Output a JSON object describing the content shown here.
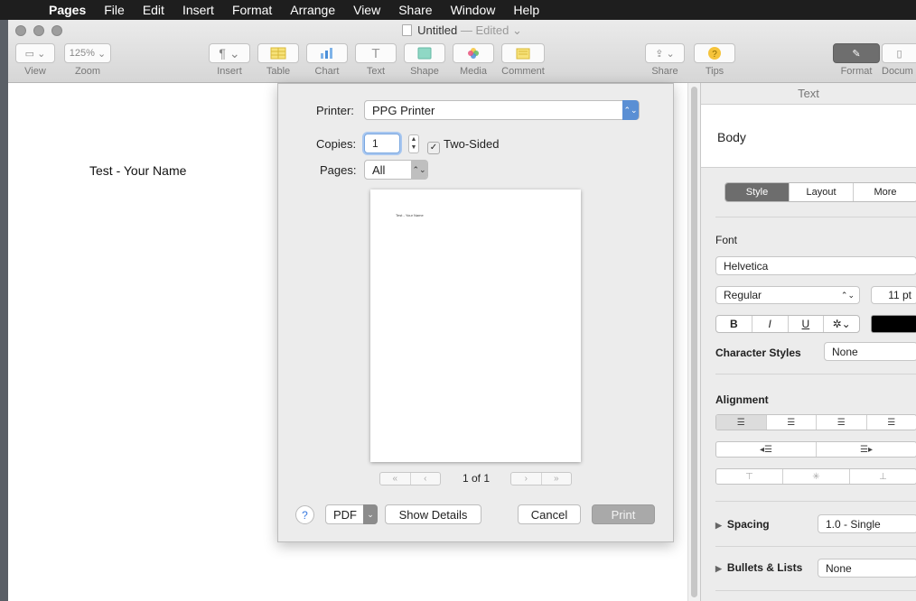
{
  "menubar": {
    "apple": "",
    "app": "Pages",
    "items": [
      "File",
      "Edit",
      "Insert",
      "Format",
      "Arrange",
      "View",
      "Share",
      "Window",
      "Help"
    ]
  },
  "window": {
    "title": "Untitled",
    "edited": "— Edited"
  },
  "toolbar": {
    "view": "View",
    "zoom_value": "125%",
    "zoom": "Zoom",
    "insert": "Insert",
    "table": "Table",
    "chart": "Chart",
    "text": "Text",
    "shape": "Shape",
    "media": "Media",
    "comment": "Comment",
    "share": "Share",
    "tips": "Tips",
    "format": "Format",
    "document": "Docum"
  },
  "document": {
    "text": "Test - Your Name"
  },
  "print_dialog": {
    "printer_label": "Printer:",
    "printer_value": "PPG Printer",
    "copies_label": "Copies:",
    "copies_value": "1",
    "two_sided_label": "Two-Sided",
    "two_sided_checked": true,
    "pages_label": "Pages:",
    "pages_value": "All",
    "preview_text": "Test - Your Name",
    "page_counter": "1 of 1",
    "help": "?",
    "pdf": "PDF",
    "show_details": "Show Details",
    "cancel": "Cancel",
    "print": "Print"
  },
  "sidebar": {
    "header": "Text",
    "paragraph_style": "Body",
    "tabs": [
      "Style",
      "Layout",
      "More"
    ],
    "font_label": "Font",
    "font_family": "Helvetica",
    "font_style": "Regular",
    "font_size": "11 pt",
    "bold": "B",
    "italic": "I",
    "underline": "U",
    "gear": "✲",
    "character_styles_label": "Character Styles",
    "character_styles_value": "None",
    "alignment_label": "Alignment",
    "spacing_label": "Spacing",
    "spacing_value": "1.0 - Single",
    "bullets_label": "Bullets & Lists",
    "bullets_value": "None",
    "text_color": "#000000"
  },
  "colors": {
    "menubar": "#1e1e1e",
    "accent": "#5a8fd4",
    "print_button": "#a9a9a9"
  }
}
